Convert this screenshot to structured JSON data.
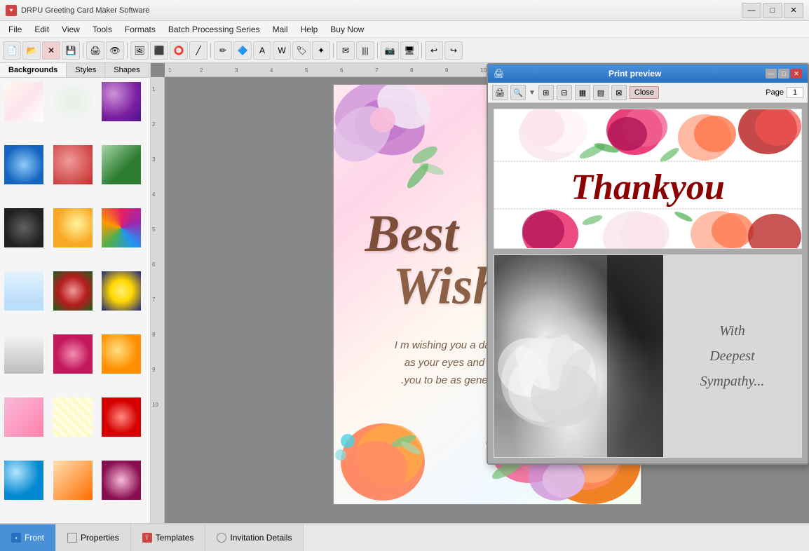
{
  "app": {
    "title": "DRPU Greeting Card Maker Software",
    "icon": "♥"
  },
  "title_bar": {
    "minimize": "—",
    "maximize": "□",
    "close": "✕"
  },
  "menu": {
    "items": [
      "File",
      "Edit",
      "View",
      "Tools",
      "Formats",
      "Batch Processing Series",
      "Mail",
      "Help",
      "Buy Now"
    ]
  },
  "left_panel": {
    "tabs": [
      "Backgrounds",
      "Styles",
      "Shapes"
    ],
    "active_tab": "Backgrounds"
  },
  "canvas": {
    "card_text_best": "Best",
    "card_text_wishes": "Wishes",
    "card_message": "I m wishing you a day which is as bright\nas your eyes and every one around\n.you to be as generous as your heart"
  },
  "print_preview": {
    "title": "Print preview",
    "close_label": "Close",
    "page_label": "Page",
    "page_num": "1",
    "card1": {
      "text": "Thankyou"
    },
    "card2": {
      "text_line1": "With",
      "text_line2": "Deepest",
      "text_line3": "Sympathy..."
    }
  },
  "bottom_tabs": {
    "items": [
      "Front",
      "Properties",
      "Templates",
      "Invitation Details"
    ]
  },
  "toolbar": {
    "icons": [
      "📂",
      "💾",
      "✕",
      "📋",
      "🖨",
      "🔍",
      "📷",
      "⬛",
      "✏",
      "🔷",
      "📝",
      "🖼",
      "🔗",
      "☰",
      "✦",
      "📧",
      "⬛",
      "→"
    ]
  }
}
